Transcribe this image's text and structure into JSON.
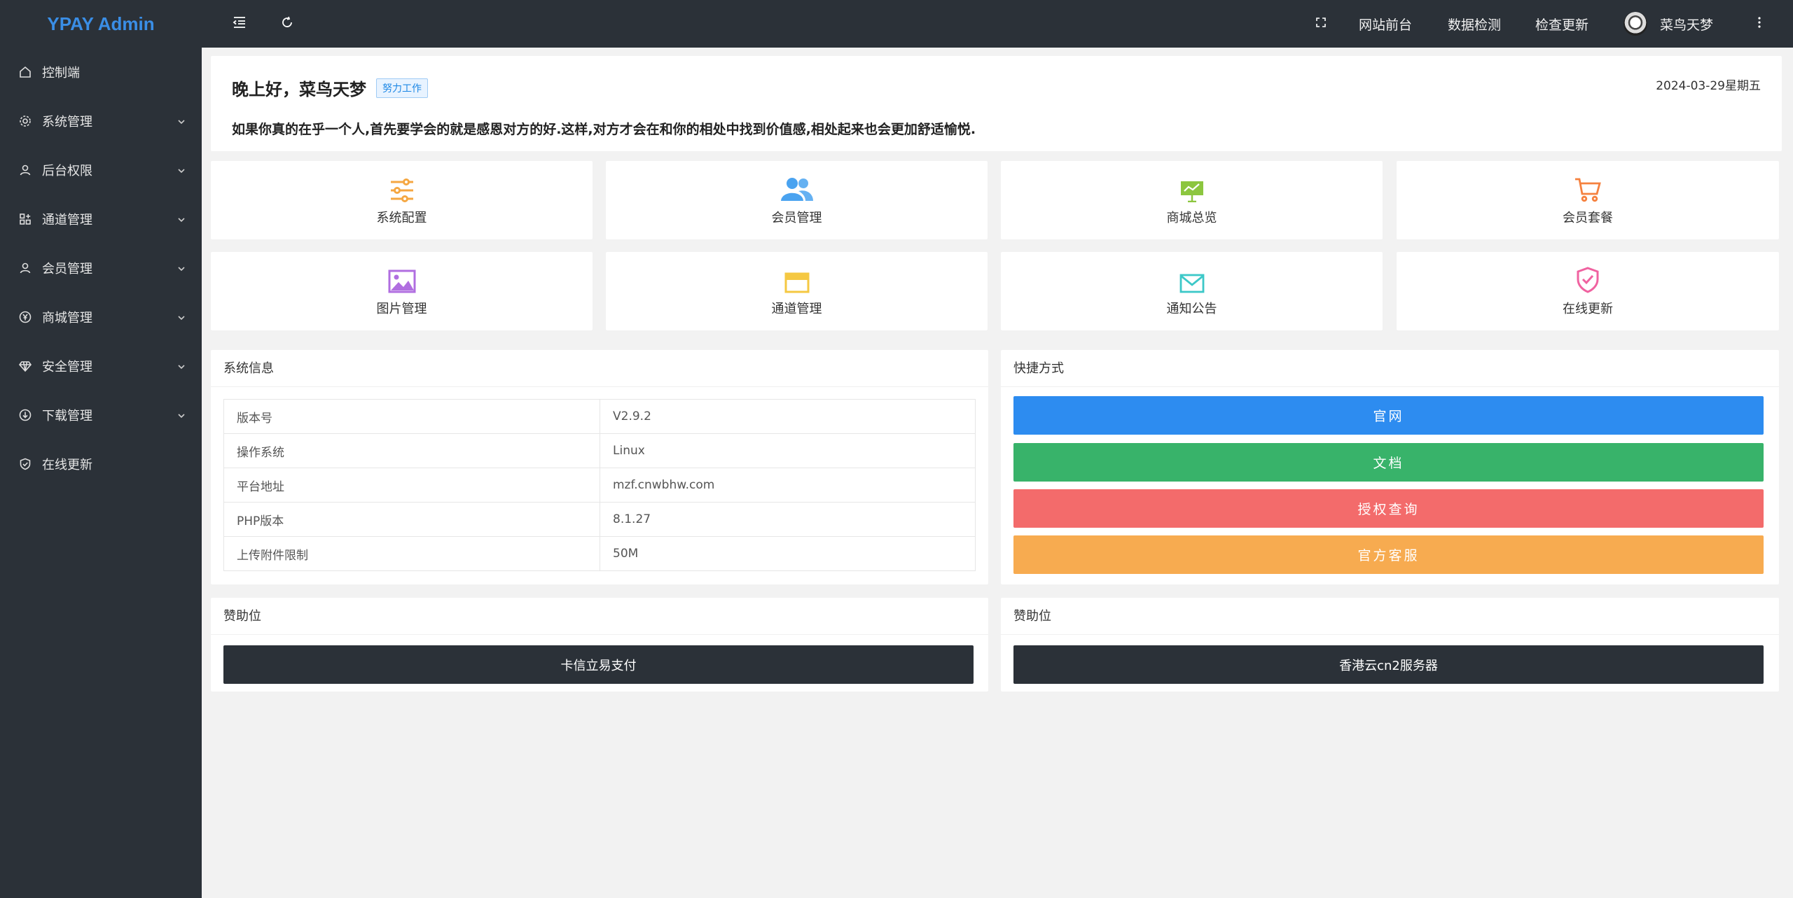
{
  "app": {
    "title": "YPAY Admin"
  },
  "sidebar": {
    "items": [
      {
        "label": "控制端",
        "icon": "home-icon",
        "has_children": false
      },
      {
        "label": "系统管理",
        "icon": "gear-icon",
        "has_children": true
      },
      {
        "label": "后台权限",
        "icon": "user-icon",
        "has_children": true
      },
      {
        "label": "通道管理",
        "icon": "apps-icon",
        "has_children": true
      },
      {
        "label": "会员管理",
        "icon": "user-icon",
        "has_children": true
      },
      {
        "label": "商城管理",
        "icon": "yen-icon",
        "has_children": true
      },
      {
        "label": "安全管理",
        "icon": "diamond-icon",
        "has_children": true
      },
      {
        "label": "下载管理",
        "icon": "download-icon",
        "has_children": true
      },
      {
        "label": "在线更新",
        "icon": "shield-check-icon",
        "has_children": false
      }
    ]
  },
  "header": {
    "links": [
      "网站前台",
      "数据检测",
      "检查更新"
    ],
    "username": "菜鸟天梦"
  },
  "greeting": {
    "title": "晚上好，菜鸟天梦",
    "tag": "努力工作",
    "date": "2024-03-29星期五",
    "quote": "如果你真的在乎一个人,首先要学会的就是感恩对方的好.这样,对方才会在和你的相处中找到价值感,相处起来也会更加舒适愉悦."
  },
  "shortcuts": [
    {
      "label": "系统配置",
      "icon": "sliders-icon",
      "color": "#f5a742"
    },
    {
      "label": "会员管理",
      "icon": "users-icon",
      "color": "#4aa3f0"
    },
    {
      "label": "商城总览",
      "icon": "presentation-icon",
      "color": "#8cc63f"
    },
    {
      "label": "会员套餐",
      "icon": "cart-icon",
      "color": "#f5813f"
    },
    {
      "label": "图片管理",
      "icon": "image-icon",
      "color": "#b06ee0"
    },
    {
      "label": "通道管理",
      "icon": "window-icon",
      "color": "#f5c842"
    },
    {
      "label": "通知公告",
      "icon": "mail-icon",
      "color": "#3cc8c8"
    },
    {
      "label": "在线更新",
      "icon": "shield-check-icon",
      "color": "#f062a0"
    }
  ],
  "system_info": {
    "title": "系统信息",
    "rows": [
      {
        "key": "版本号",
        "value": "V2.9.2"
      },
      {
        "key": "操作系统",
        "value": "Linux"
      },
      {
        "key": "平台地址",
        "value": "mzf.cnwbhw.com"
      },
      {
        "key": "PHP版本",
        "value": "8.1.27"
      },
      {
        "key": "上传附件限制",
        "value": "50M"
      }
    ]
  },
  "quick_links": {
    "title": "快捷方式",
    "buttons": [
      {
        "label": "官网",
        "color": "#2d8cf0"
      },
      {
        "label": "文档",
        "color": "#38b36a"
      },
      {
        "label": "授权查询",
        "color": "#f36b6b"
      },
      {
        "label": "官方客服",
        "color": "#f7ab50"
      }
    ]
  },
  "sponsors": [
    {
      "title": "赞助位",
      "button": "卡信立易支付"
    },
    {
      "title": "赞助位",
      "button": "香港云cn2服务器"
    }
  ]
}
